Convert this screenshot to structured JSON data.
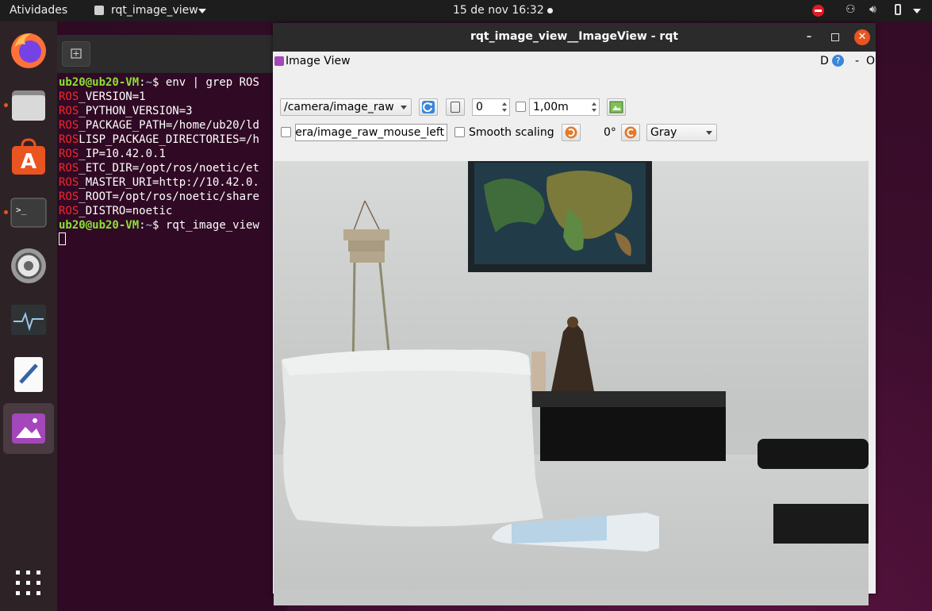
{
  "topbar": {
    "activities": "Atividades",
    "app_menu": "rqt_image_view",
    "clock": "15 de nov  16:32"
  },
  "dock": {
    "items": [
      "firefox-icon",
      "files-icon",
      "software-icon",
      "terminal-icon",
      "settings-icon",
      "system-monitor-icon",
      "text-editor-icon",
      "image-viewer-icon"
    ],
    "show_apps": "show-applications-icon"
  },
  "terminal": {
    "lines": [
      {
        "user": "ub20@ub20-VM",
        "path": "~",
        "cmd": "$ env | grep ROS"
      },
      {
        "pre": "ROS",
        "rest": "_VERSION=1"
      },
      {
        "pre": "ROS",
        "rest": "_PYTHON_VERSION=3"
      },
      {
        "pre": "ROS",
        "rest": "_PACKAGE_PATH=/home/ub20/ld"
      },
      {
        "pre": "ROS",
        "rest": "LISP_PACKAGE_DIRECTORIES=/h"
      },
      {
        "pre": "ROS",
        "rest": "_IP=10.42.0.1"
      },
      {
        "pre": "ROS",
        "rest": "_ETC_DIR=/opt/ros/noetic/et"
      },
      {
        "pre": "ROS",
        "rest": "_MASTER_URI=http://10.42.0."
      },
      {
        "pre": "ROS",
        "rest": "_ROOT=/opt/ros/noetic/share"
      },
      {
        "pre": "ROS",
        "rest": "_DISTRO=noetic"
      },
      {
        "user": "ub20@ub20-VM",
        "path": "~",
        "cmd": "$ rqt_image_view"
      }
    ]
  },
  "rqt": {
    "title": "rqt_image_view__ImageView - rqt",
    "plugin_title": "Image View",
    "plugin_d": "D",
    "plugin_help": "?",
    "plugin_dash": "-",
    "plugin_o": "O",
    "topic": "/camera/image_raw",
    "spin_value": "0",
    "distance_value": "1,00m",
    "mouse_topic": "era/image_raw_mouse_left",
    "smooth_label": "Smooth scaling",
    "rotation": "0°",
    "color_mode": "Gray"
  },
  "colors": {
    "ubuntu_orange": "#e95420",
    "terminal_bg": "#300a24",
    "prompt_green": "#8ae234",
    "prompt_blue": "#729fcf",
    "ros_red": "#ef2929"
  }
}
